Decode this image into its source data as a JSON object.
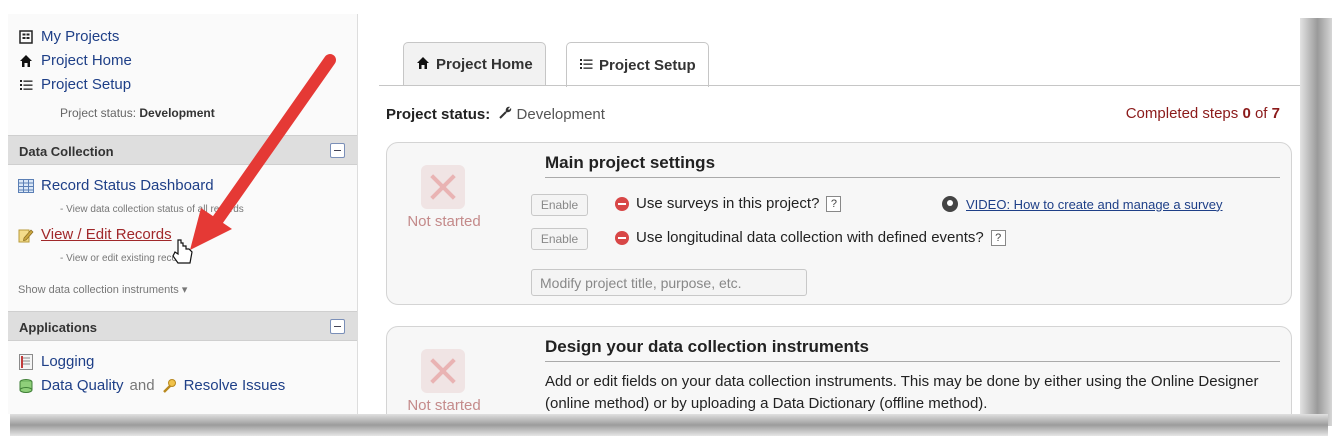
{
  "sidebar": {
    "links": [
      {
        "label": "My Projects",
        "icon": "project-list-icon"
      },
      {
        "label": "Project Home",
        "icon": "home-icon"
      },
      {
        "label": "Project Setup",
        "icon": "list-icon"
      }
    ],
    "status_label": "Project status:",
    "status_value": "Development",
    "sections": [
      {
        "title": "Data Collection",
        "items": [
          {
            "label": "Record Status Dashboard",
            "description": "- View data collection status of all records",
            "icon": "grid-icon"
          },
          {
            "label": "View / Edit Records",
            "description": "- View or edit existing records",
            "icon": "edit-records-icon"
          }
        ],
        "show_instruments": "Show data collection instruments ▾"
      },
      {
        "title": "Applications",
        "items": [
          {
            "label": "Logging",
            "icon": "log-icon"
          },
          {
            "label": "Data Quality",
            "icon": "data-quality-icon"
          }
        ],
        "and_text": "and",
        "resolve_label": "Resolve Issues"
      }
    ]
  },
  "tabs": [
    {
      "label": "Project Home",
      "icon": "home-icon",
      "active": false
    },
    {
      "label": "Project Setup",
      "icon": "list-icon",
      "active": true
    }
  ],
  "main": {
    "status_label": "Project status:",
    "status_value": "Development",
    "completed_prefix": "Completed steps",
    "completed_done": "0",
    "completed_of": "of",
    "completed_total": "7",
    "cards": [
      {
        "status": "Not started",
        "title": "Main project settings",
        "options": [
          {
            "button": "Enable",
            "label": "Use surveys in this project?"
          },
          {
            "button": "Enable",
            "label": "Use longitudinal data collection with defined events?"
          }
        ],
        "video": "VIDEO: How to create and manage a survey",
        "modify_button": "Modify project title, purpose, etc."
      },
      {
        "status": "Not started",
        "title": "Design your data collection instruments",
        "description": "Add or edit fields on your data collection instruments. This may be done by either using the Online Designer (online method) or by uploading a Data Dictionary (offline method)."
      }
    ]
  },
  "colors": {
    "link": "#1e3f87",
    "completed": "#8b1a1a",
    "status_dot": "#d84747",
    "arrow": "#e53935"
  }
}
